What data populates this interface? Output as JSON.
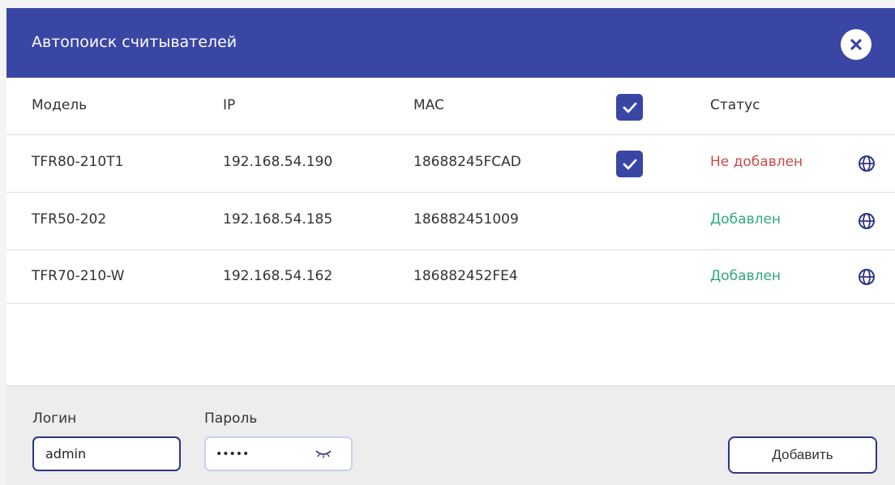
{
  "dialog": {
    "title": "Автопоиск считывателей"
  },
  "table": {
    "headers": {
      "model": "Модель",
      "ip": "IP",
      "mac": "MAC",
      "status": "Статус"
    },
    "select_all_checked": true,
    "rows": [
      {
        "model": "TFR80-210T1",
        "ip": "192.168.54.190",
        "mac": "18688245FCAD",
        "checked": true,
        "status": "Не добавлен",
        "status_color": "#c94b4b"
      },
      {
        "model": "TFR50-202",
        "ip": "192.168.54.185",
        "mac": "186882451009",
        "checked": false,
        "status": "Добавлен",
        "status_color": "#2fa879"
      },
      {
        "model": "TFR70-210-W",
        "ip": "192.168.54.162",
        "mac": "186882452FE4",
        "checked": false,
        "status": "Добавлен",
        "status_color": "#2fa879"
      }
    ]
  },
  "footer": {
    "login_label": "Логин",
    "login_value": "admin",
    "password_label": "Пароль",
    "password_value": "•••••",
    "add_button": "Добавить"
  },
  "colors": {
    "accent": "#3a46a3",
    "not_added": "#c94b4b",
    "added": "#2fa879"
  },
  "icons": {
    "close": "close-icon",
    "checkbox": "checkmark-icon",
    "globe": "globe-icon",
    "password_toggle": "eye-closed-icon"
  }
}
